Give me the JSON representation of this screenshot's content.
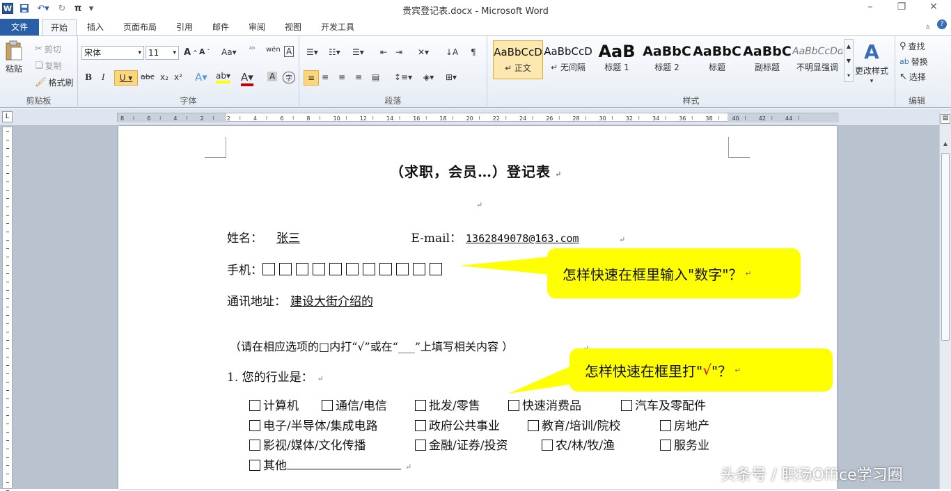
{
  "window": {
    "title": "贵宾登记表.docx - Microsoft Word"
  },
  "tabs": [
    "文件",
    "开始",
    "插入",
    "页面布局",
    "引用",
    "邮件",
    "审阅",
    "视图",
    "开发工具"
  ],
  "clipboard": {
    "paste": "粘贴",
    "cut": "剪切",
    "copy": "复制",
    "format_painter": "格式刷",
    "label": "剪贴板"
  },
  "font": {
    "name": "宋体",
    "size": "11",
    "label": "字体"
  },
  "paragraph": {
    "label": "段落"
  },
  "styles": {
    "label": "样式",
    "items": [
      {
        "sample": "AaBbCcD",
        "name": "↵ 正文"
      },
      {
        "sample": "AaBbCcD",
        "name": "↵ 无间隔"
      },
      {
        "sample": "AaB",
        "name": "标题 1"
      },
      {
        "sample": "AaBbC",
        "name": "标题 2"
      },
      {
        "sample": "AaBbC",
        "name": "标题"
      },
      {
        "sample": "AaBbC",
        "name": "副标题"
      },
      {
        "sample": "AaBbCcDd",
        "name": "不明显强调"
      }
    ],
    "change_styles": "更改样式"
  },
  "editing": {
    "find": "查找",
    "replace": "替换",
    "select": "选择",
    "label": "编辑"
  },
  "ruler_numbers": [
    "8",
    "6",
    "4",
    "2",
    "2",
    "4",
    "6",
    "8",
    "10",
    "12",
    "14",
    "16",
    "18",
    "20",
    "22",
    "24",
    "26",
    "28",
    "30",
    "32",
    "34",
    "36",
    "38",
    "40",
    "42",
    "44"
  ],
  "document": {
    "title": "（求职，会员…）登记表",
    "name_label": "姓名：",
    "name_value": "张三",
    "email_label": "E-mail：",
    "email_value": "1362849078@163.com",
    "phone_label": "手机：",
    "phone_box_count": 11,
    "address_label": "通讯地址：",
    "address_value": "建设大街介绍的",
    "instruction": "（请在相应选项的□内打“√”或在“___”上填写相关内容 ）",
    "q1": "1.   您的行业是：",
    "options_row1": [
      "计算机",
      "通信/电信",
      "批发/零售",
      "快速消费品",
      "汽车及零配件"
    ],
    "options_row2": [
      "电子/半导体/集成电路",
      "政府公共事业",
      "教育/培训/院校",
      "房地产"
    ],
    "options_row3": [
      "影视/媒体/文化传播",
      "金融/证券/投资",
      "农/林/牧/渔",
      "服务业"
    ],
    "other": "其他"
  },
  "callouts": {
    "first": "怎样快速在框里输入\"数字\"？",
    "second_a": "怎样快速在框里打\"",
    "second_check": "√",
    "second_b": "\"？"
  },
  "colors": {
    "callout_bg": "#ffff00",
    "file_tab": "#2a5fa8",
    "check_red": "#e00000"
  },
  "watermark": "头条号 / 职场Office学习圈"
}
